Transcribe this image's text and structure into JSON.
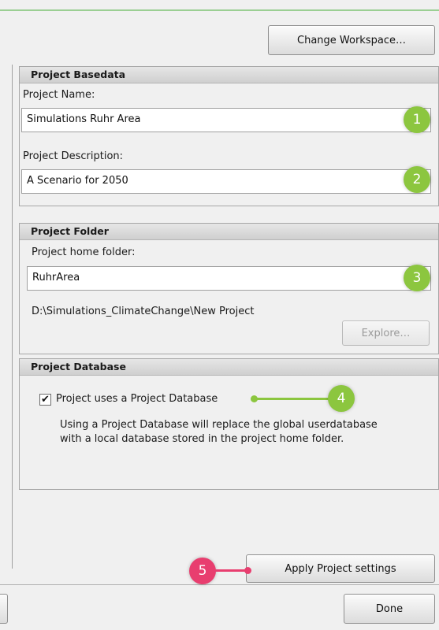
{
  "toolbar": {
    "change_workspace_label": "Change Workspace…"
  },
  "basedata": {
    "header": "Project Basedata",
    "name_label": "Project Name:",
    "name_value": "Simulations Ruhr Area",
    "description_label": "Project Description:",
    "description_value": "A Scenario for 2050"
  },
  "folder": {
    "header": "Project Folder",
    "home_label": "Project home folder:",
    "home_value": "RuhrArea",
    "path_text": "D:\\Simulations_ClimateChange\\New Project",
    "explore_label": "Explore…"
  },
  "database": {
    "header": "Project Database",
    "checkbox_label": "Project uses a Project Database",
    "checkbox_checked": true,
    "checkmark": "✔",
    "info_line1": "Using a Project Database will replace the global userdatabase",
    "info_line2": "with a local database stored in the project home folder."
  },
  "actions": {
    "apply_label": "Apply Project settings",
    "done_label": "Done"
  },
  "callouts": {
    "n1": "1",
    "n2": "2",
    "n3": "3",
    "n4": "4",
    "n5": "5"
  },
  "colors": {
    "callout_green": "#8cc63f",
    "callout_pink": "#e83e6f"
  }
}
